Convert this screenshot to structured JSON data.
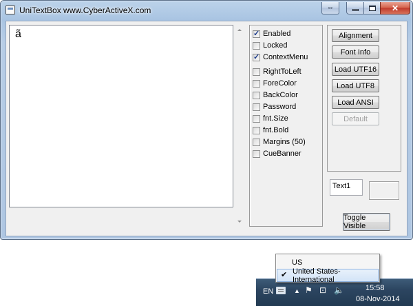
{
  "window": {
    "title": "UniTextBox www.CyberActiveX.com",
    "swap_glyph": "⇔",
    "close_glyph": "✕"
  },
  "textbox": {
    "content": "ã"
  },
  "checkboxes": [
    {
      "label": "Enabled",
      "checked": true
    },
    {
      "label": "Locked",
      "checked": false
    },
    {
      "label": "ContextMenu",
      "checked": true
    },
    {
      "label": "RightToLeft",
      "checked": false
    },
    {
      "label": "ForeColor",
      "checked": false
    },
    {
      "label": "BackColor",
      "checked": false
    },
    {
      "label": "Password",
      "checked": false
    },
    {
      "label": "fnt.Size",
      "checked": false
    },
    {
      "label": "fnt.Bold",
      "checked": false
    },
    {
      "label": "Margins (50)",
      "checked": false
    },
    {
      "label": "CueBanner",
      "checked": false
    }
  ],
  "buttons": [
    {
      "label": "Alignment",
      "enabled": true
    },
    {
      "label": "Font Info",
      "enabled": true
    },
    {
      "label": "Load UTF16",
      "enabled": true
    },
    {
      "label": "Load UTF8",
      "enabled": true
    },
    {
      "label": "Load ANSI",
      "enabled": true
    },
    {
      "label": "Default",
      "enabled": false
    }
  ],
  "text1": {
    "value": "Text1"
  },
  "toggle": {
    "label": "Toggle Visible"
  },
  "language_menu": {
    "items": [
      {
        "label": "US",
        "selected": false
      },
      {
        "label": "United States-International",
        "selected": true
      }
    ],
    "check_glyph": "✔"
  },
  "taskbar": {
    "lang_code": "EN",
    "up_arrow": "▲",
    "flag_glyph": "⚑",
    "network_glyph": "⊡",
    "volume_glyph": "🔈",
    "time": "15:58",
    "date": "08-Nov-2014"
  },
  "colors": {
    "titlebar": "#a9c4e2",
    "taskbar": "#2c4560",
    "close_button": "#c0392b"
  }
}
